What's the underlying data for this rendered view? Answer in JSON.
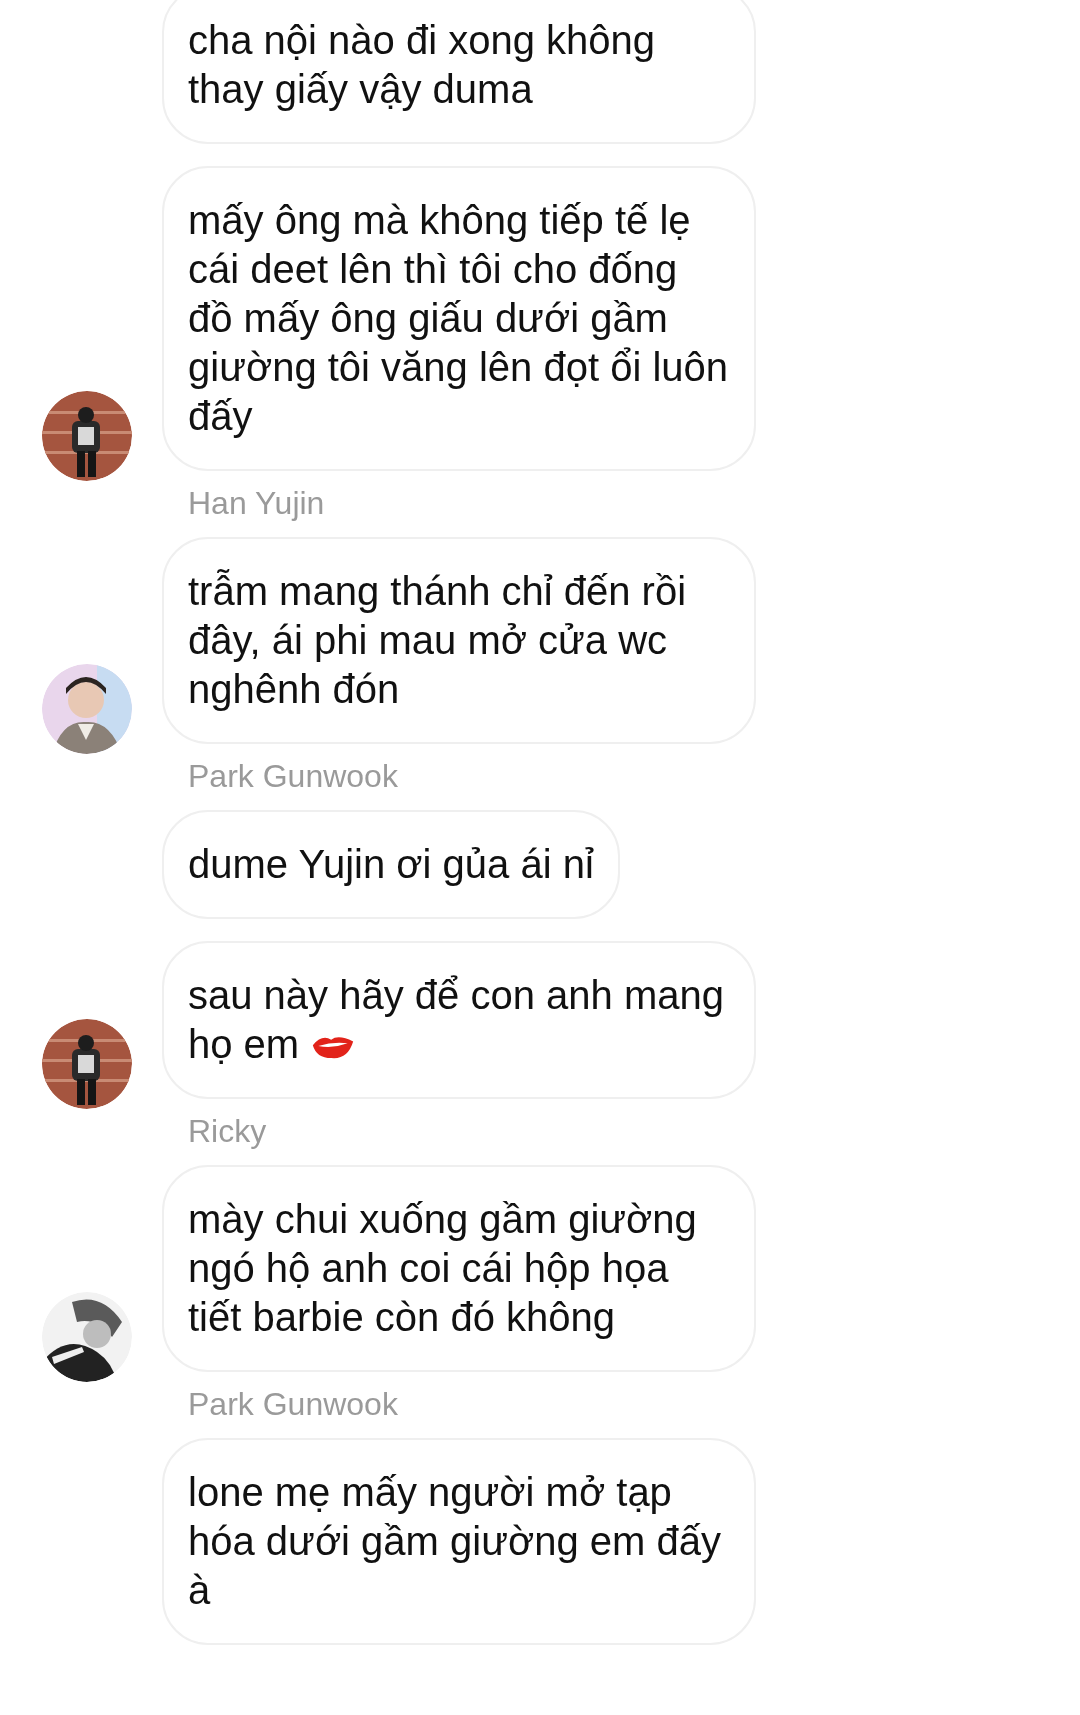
{
  "groups": [
    {
      "avatar": {
        "kind": "picture"
      },
      "messages": [
        {
          "kind": "text",
          "text": "cha nội nào đi xong không thay giấy vậy duma"
        },
        {
          "kind": "text",
          "text": "mấy ông mà không tiếp tế lẹ cái deet lên thì tôi cho đống đồ mấy ông giấu dưới gầm giường tôi văng lên đọt ổi luôn đấy"
        }
      ]
    },
    {
      "sender": "Han Yujin",
      "avatar": {
        "kind": "picture"
      },
      "messages": [
        {
          "kind": "text",
          "text": "trẫm mang thánh chỉ đến rồi đây, ái phi mau mở cửa wc nghênh đón"
        }
      ]
    },
    {
      "sender": "Park Gunwook",
      "avatar": {
        "kind": "picture"
      },
      "messages": [
        {
          "kind": "text",
          "text": "dume Yujin ơi gủa ái nỉ"
        },
        {
          "kind": "emoji",
          "text": "sau này hãy để con anh mang họ em"
        }
      ]
    },
    {
      "sender": "Ricky",
      "avatar": {
        "kind": "picture"
      },
      "messages": [
        {
          "kind": "text",
          "text": "mày chui xuống gầm giường ngó hộ anh coi cái hộp họa tiết barbie còn đó không"
        }
      ]
    },
    {
      "sender": "Park Gunwook",
      "messages": [
        {
          "kind": "text",
          "text": "lone mẹ mấy người mở tạp hóa dưới gầm giường em đấy à"
        }
      ]
    }
  ]
}
